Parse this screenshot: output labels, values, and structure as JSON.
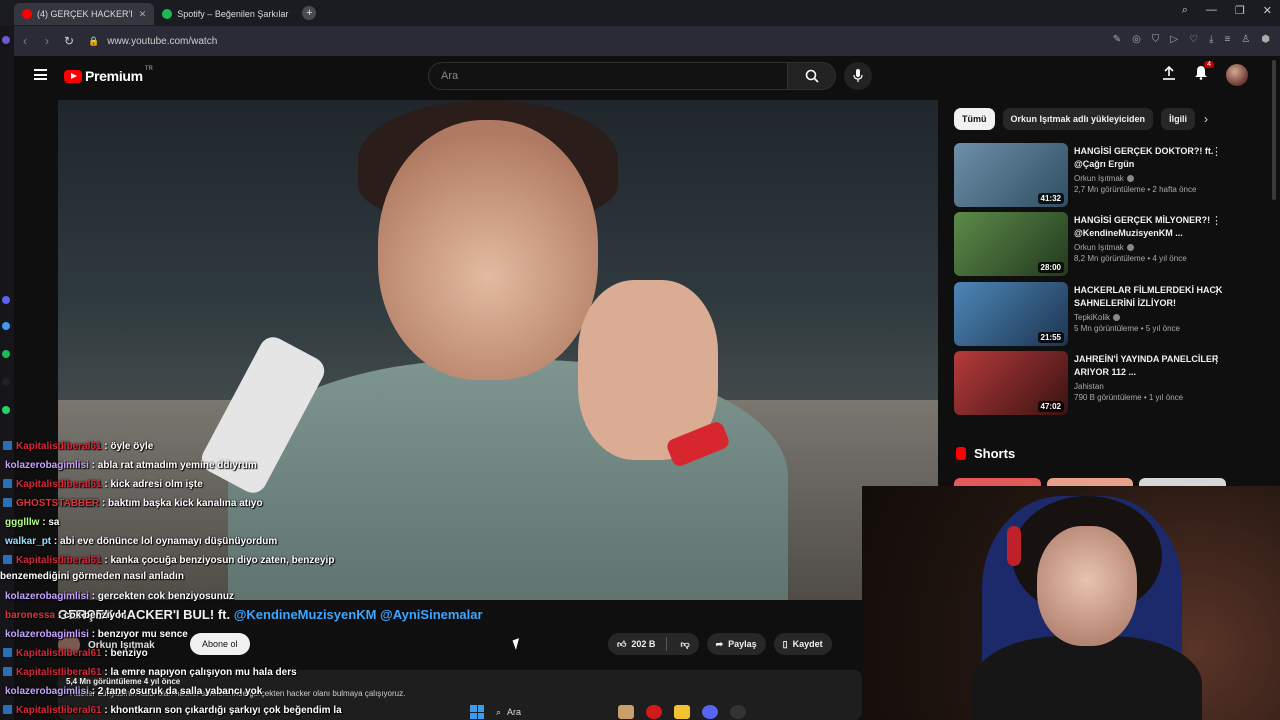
{
  "browser": {
    "tabs": [
      {
        "label": "(4) GERÇEK HACKER'I",
        "favicon_color": "#ff0000",
        "active": true
      },
      {
        "label": "Spotify – Beğenilen Şarkılar",
        "favicon_color": "#1db954",
        "active": false
      }
    ],
    "url": "www.youtube.com/watch"
  },
  "youtube": {
    "logo_text": "Premium",
    "logo_region": "TR",
    "search_placeholder": "Ara",
    "notification_count": "4"
  },
  "video": {
    "title_prefix": "GERÇEK HACKER'I BUL! ft.",
    "mention1": "@KendineMuzisyenKM",
    "mention2": "@AyniSinemalar",
    "channel": "Orkun Işıtmak",
    "subscribe": "Abone ol",
    "likes": "202 B",
    "share": "Paylaş",
    "save": "Kaydet",
    "stats": "5,4 Mn görüntüleme  4 yıl önce",
    "description": "Hacker dünyasının kalbi olan hacker sahnelerinde gerçekten hacker olanı bulmaya çalışıyoruz."
  },
  "chips": [
    "Tümü",
    "Orkun Işıtmak adlı yükleyiciden",
    "İlgili"
  ],
  "recommendations": [
    {
      "title": "HANGİSİ GERÇEK DOKTOR?! ft. @Çağrı Ergün",
      "channel": "Orkun Işıtmak",
      "stats": "2,7 Mn görüntüleme • 2 hafta önce",
      "duration": "41:32",
      "thumb": "#4a6f8a"
    },
    {
      "title": "HANGİSİ GERÇEK MİLYONER?! @KendineMuzisyenKM ...",
      "channel": "Orkun Işıtmak",
      "stats": "8,2 Mn görüntüleme • 4 yıl önce",
      "duration": "28:00",
      "thumb": "#3c6a3a"
    },
    {
      "title": "HACKERLAR FİLMLERDEKİ HACK SAHNELERİNİ İZLİYOR!",
      "channel": "TepkiKolik",
      "stats": "5 Mn görüntüleme • 5 yıl önce",
      "duration": "21:55",
      "thumb": "#2f5f86"
    },
    {
      "title": "JAHREİN'İ YAYINDA PANELCİLER ARIYOR 112 ...",
      "channel": "Jahistan",
      "stats": "790 B görüntüleme • 1 yıl önce",
      "duration": "47:02",
      "thumb": "#8a2a2a"
    }
  ],
  "shorts_label": "Shorts",
  "chat": [
    {
      "user": "Kapitalistliberal61",
      "color": "#d9263a",
      "text": ": öyle öyle",
      "icon": true
    },
    {
      "user": "kolazerobagimlisi",
      "color": "#c8a4ff",
      "text": ": abla rat atmadım yemine ddıyrum",
      "icon": false
    },
    {
      "user": "Kapitalistliberal61",
      "color": "#d9263a",
      "text": ": kick adresi olm işte",
      "icon": true
    },
    {
      "user": "GHOSTSTABBER",
      "color": "#e0343f",
      "text": ": baktım başka kick kanalına atıyo",
      "icon": true
    },
    {
      "user": "ggglllw",
      "color": "#b6ff8a",
      "text": ": sa",
      "icon": false
    },
    {
      "user": "walkar_pt",
      "color": "#9be0ff",
      "text": ": abi eve dönünce lol oynamayı düşünüyordum",
      "icon": false
    },
    {
      "user": "Kapitalistliberal61",
      "color": "#d9263a",
      "text": ": kanka çocuğa benziyosun diyo zaten, benzeyip benzemediğini görmeden nasıl anladın",
      "icon": true,
      "wrap": true
    },
    {
      "user": "kolazerobagimlisi",
      "color": "#c8a4ff",
      "text": ": gercekten cok benziyosunuz",
      "icon": false
    },
    {
      "user": "baronessa",
      "color": "#e0343f",
      "text": ": cok benziyor",
      "icon": false
    },
    {
      "user": "kolazerobagimlisi",
      "color": "#c8a4ff",
      "text": ": benzıyor mu sence",
      "icon": false
    },
    {
      "user": "Kapitalistliberal61",
      "color": "#d9263a",
      "text": ": benziyo",
      "icon": true
    },
    {
      "user": "Kapitalistliberal61",
      "color": "#d9263a",
      "text": ": la emre napıyon çalışıyon mu hala ders",
      "icon": true
    },
    {
      "user": "kolazerobagimlisi",
      "color": "#c8a4ff",
      "text": ": 2 tane osuruk da salla yabancı yok",
      "icon": false
    },
    {
      "user": "Kapitalistliberal61",
      "color": "#d9263a",
      "text": ": khontkarın son çıkardığı şarkıyı çok beğendim la",
      "icon": true
    }
  ],
  "taskbar": {
    "search": "Ara"
  }
}
